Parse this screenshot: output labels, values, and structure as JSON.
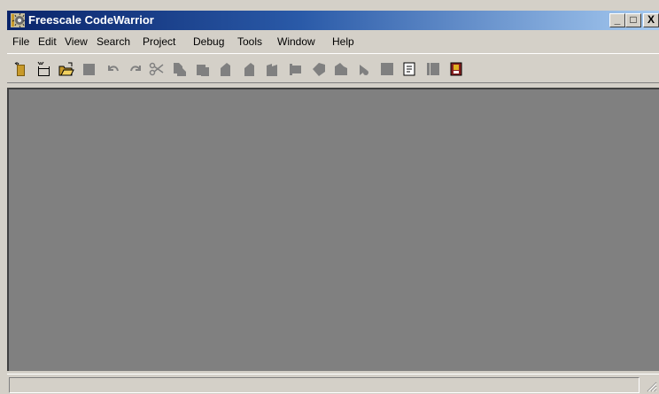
{
  "window": {
    "title": "Freescale CodeWarrior",
    "minimize_label": "_",
    "maximize_label": "□",
    "close_label": "X"
  },
  "menubar": {
    "items": [
      "File",
      "Edit",
      "View",
      "Search",
      "Project",
      "Debug",
      "Tools",
      "Window",
      "Help"
    ]
  },
  "toolbar": {
    "buttons": [
      "new-text-file-icon",
      "new-project-icon",
      "open-folder-icon",
      "save-icon",
      "undo-icon",
      "redo-icon",
      "cut-icon",
      "copy-icon",
      "paste-icon",
      "find-icon",
      "find-next-icon",
      "replace-icon",
      "bring-up-to-date-icon",
      "make-icon",
      "stop-build-icon",
      "debug-icon",
      "run-icon",
      "browse-icon",
      "file-list-icon",
      "properties-icon",
      "help-book-icon"
    ]
  },
  "colors": {
    "title_gradient_start": "#0a246a",
    "title_gradient_end": "#a6caf0",
    "window_face": "#d4d0c8",
    "client_area": "#808080"
  }
}
